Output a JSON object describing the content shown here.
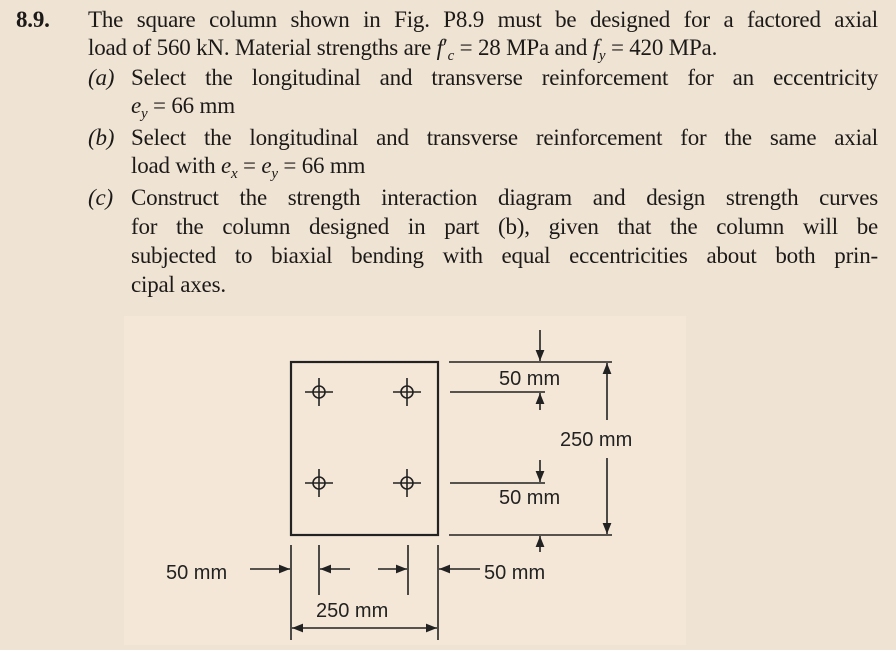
{
  "problem": {
    "number": "8.9.",
    "intro_line1": "The square column shown in Fig. P8.9 must be designed for a factored axial",
    "intro_line2_a": "load of 560 kN. Material strengths are ",
    "fc_symbol": "f",
    "fc_sub": "c",
    "fc_value": " = 28 MPa and ",
    "fy_symbol": "f",
    "fy_sub": "y",
    "fy_value": " = 420 MPa.",
    "parts": [
      {
        "label": "(a)",
        "line1": "Select the longitudinal and transverse reinforcement for an eccentricity",
        "ecc_symbol": "e",
        "ecc_sub": "y",
        "ecc_value": " = 66 mm"
      },
      {
        "label": "(b)",
        "line1": "Select the longitudinal and transverse reinforcement for the same axial",
        "line2_a": "load with ",
        "ex_symbol": "e",
        "ex_sub": "x",
        "mid": " = ",
        "ey_symbol": "e",
        "ey_sub": "y",
        "ecc_value": " = 66 mm"
      },
      {
        "label": "(c)",
        "line1": "Construct the strength interaction diagram and design strength curves",
        "line2": "for the column designed in part (b), given that the column will be",
        "line3": "subjected to biaxial bending with equal eccentricities about both prin-",
        "line4": "cipal axes."
      }
    ]
  },
  "figure": {
    "dim_top_cover": "50 mm",
    "dim_height": "250 mm",
    "dim_bottom_cover": "50 mm",
    "dim_left_cover": "50 mm",
    "dim_right_cover": "50 mm",
    "dim_width": "250 mm"
  }
}
